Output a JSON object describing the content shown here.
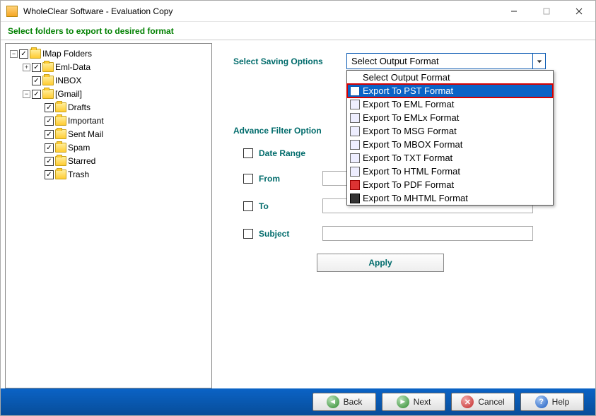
{
  "window": {
    "title": "WholeClear Software - Evaluation Copy"
  },
  "header": {
    "instruction": "Select folders to export to desired format"
  },
  "tree": {
    "root": "IMap Folders",
    "emlData": "Eml-Data",
    "inbox": "INBOX",
    "gmail": "[Gmail]",
    "drafts": "Drafts",
    "important": "Important",
    "sentMail": "Sent Mail",
    "spam": "Spam",
    "starred": "Starred",
    "trash": "Trash"
  },
  "form": {
    "savingLabel": "Select Saving Options",
    "comboValue": "Select Output Format",
    "options": {
      "header": "Select Output Format",
      "pst": "Export To PST Format",
      "eml": "Export To EML Format",
      "emlx": "Export To EMLx Format",
      "msg": "Export To MSG Format",
      "mbox": "Export To MBOX Format",
      "txt": "Export To TXT Format",
      "html": "Export To HTML Format",
      "pdf": "Export To PDF Format",
      "mhtml": "Export To MHTML Format"
    },
    "advanceLabel": "Advance Filter Option",
    "dateRange": "Date Range",
    "from": "From",
    "to": "To",
    "subject": "Subject",
    "apply": "Apply"
  },
  "footer": {
    "back": "Back",
    "next": "Next",
    "cancel": "Cancel",
    "help": "Help"
  }
}
